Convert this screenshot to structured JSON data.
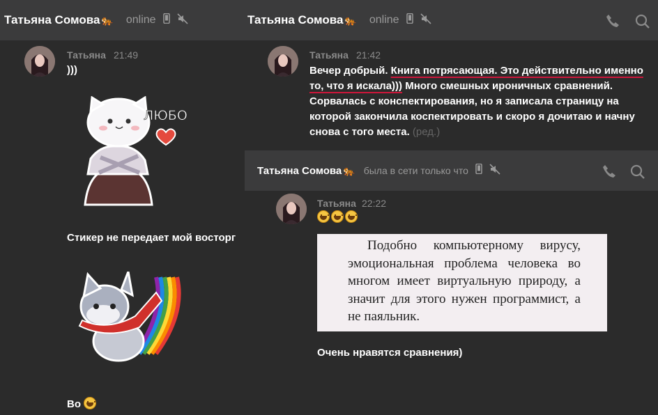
{
  "left": {
    "header": {
      "name": "Татьяна Сомова",
      "status": "online"
    },
    "author": "Татьяна",
    "time": "21:49",
    "first_text": ")))",
    "caption1": "Стикер не передает мой восторг",
    "sticker1_word": "ЛЮБО",
    "last_text": "Во"
  },
  "right_top": {
    "header": {
      "name": "Татьяна Сомова",
      "status": "online"
    },
    "author": "Татьяна",
    "time": "21:42",
    "msg_a": "Вечер добрый. ",
    "msg_b": "Книга потрясающая. Это действительно именно то, что я искала)))",
    "msg_c": " Много смешных ироничных сравнений. Сорвалась с конспектирования, но я записала страницу на которой закончила коспектировать и скоро я дочитаю и начну снова с того места.",
    "edited": "(ред.)"
  },
  "right_bottom": {
    "header": {
      "name": "Татьяна Сомова",
      "status": "была в сети только что"
    },
    "author": "Татьяна",
    "time": "22:22",
    "book_text": "Подобно компьютерному вирусу, эмоциональная проблема человека во многом имеет виртуальную природу, а значит для этого нужен программист, а не паяльник.",
    "caption": "Очень нравятся сравнения)"
  },
  "icons": [
    "cat-emoji-icon",
    "phone-device-icon",
    "mute-icon",
    "phone-call-icon",
    "search-icon",
    "grin-emoji-icon"
  ],
  "colors": {
    "header_bg": "#3b3b3c",
    "panel_bg": "#2b2b2b",
    "underline": "#d0163b",
    "muted_text": "#9a9a9a"
  }
}
